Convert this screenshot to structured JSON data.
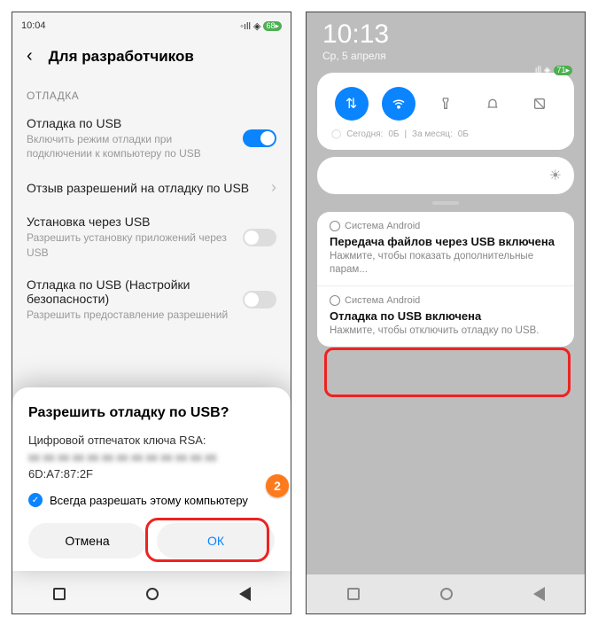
{
  "left": {
    "status_time": "10:04",
    "battery": "68",
    "header_title": "Для разработчиков",
    "section": "ОТЛАДКА",
    "usb_debug": {
      "title": "Отладка по USB",
      "sub": "Включить режим отладки при подключении к компьютеру по USB"
    },
    "revoke": {
      "title": "Отзыв разрешений на отладку по USB"
    },
    "install_usb": {
      "title": "Установка через USB",
      "sub": "Разрешить установку приложений через USB"
    },
    "usb_sec": {
      "title": "Отладка по USB (Настройки безопасности)",
      "sub": "Разрешить предоставление разрешений"
    },
    "dialog": {
      "title": "Разрешить отладку по USB?",
      "line1": "Цифровой отпечаток ключа RSA:",
      "blur": "xx xx xx xx xx xx xx xx xx xx xx xx xx",
      "fp": "6D:A7:87:2F",
      "always": "Всегда разрешать этому компьютеру",
      "cancel": "Отмена",
      "ok": "ОК"
    },
    "badge": "2"
  },
  "right": {
    "time": "10:13",
    "date": "Ср, 5 апреля",
    "battery": "71",
    "data": {
      "today_label": "Сегодня:",
      "today_val": "0Б",
      "month_label": "За месяц:",
      "month_val": "0Б"
    },
    "notif_source": "Система Android",
    "n1": {
      "title": "Передача файлов через USB включена",
      "sub": "Нажмите, чтобы показать дополнительные парам..."
    },
    "n2": {
      "title": "Отладка по USB включена",
      "sub": "Нажмите, чтобы отключить отладку по USB."
    }
  }
}
